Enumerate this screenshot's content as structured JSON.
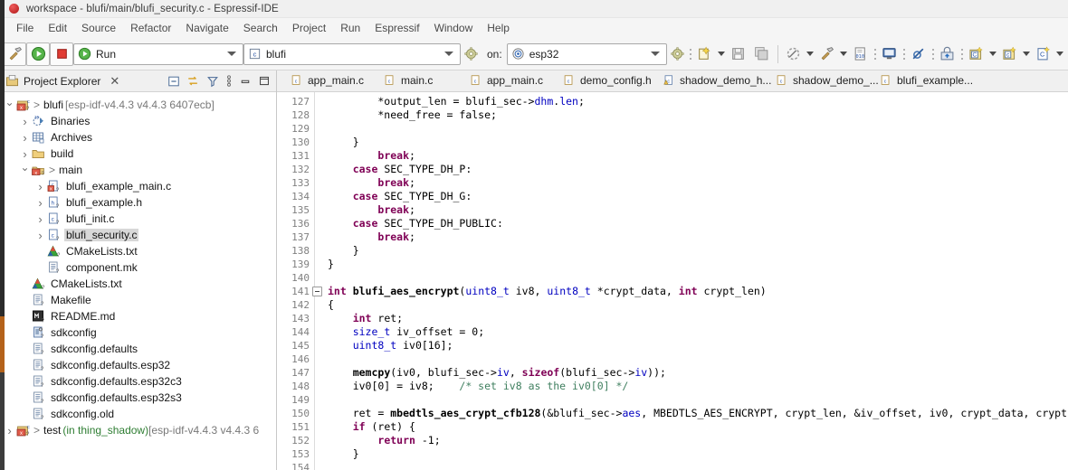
{
  "window": {
    "title": "workspace - blufi/main/blufi_security.c - Espressif-IDE",
    "app_icon": "espressif-logo-icon"
  },
  "menubar": {
    "items": [
      "File",
      "Edit",
      "Source",
      "Refactor",
      "Navigate",
      "Search",
      "Project",
      "Run",
      "Espressif",
      "Window",
      "Help"
    ]
  },
  "toolbar": {
    "build_button": "hammer-build-icon",
    "run_button": "run-green-play-icon",
    "stop_button": "stop-red-square-icon",
    "launch_mode": {
      "label": "Run",
      "icon": "run-green-play-icon",
      "caret": "chevron-down-icon"
    },
    "project_combo": {
      "label": "blufi",
      "icon": "c-project-icon",
      "caret": "chevron-down-icon",
      "gear": "gear-icon"
    },
    "on_label": "on:",
    "target_combo": {
      "label": "esp32",
      "icon": "target-chip-icon",
      "caret": "chevron-down-icon",
      "gear": "gear-icon"
    },
    "icons": [
      "new-file-icon",
      "save-icon",
      "save-all-icon",
      "build-all-icon",
      "hammer-build-icon",
      "binary-file-icon",
      "open-terminal-icon",
      "skip-breakpoints-icon",
      "open-perspective-icon",
      "new-c-class-icon",
      "new-c-file-icon",
      "new-c-source-icon",
      "git-icon"
    ]
  },
  "project_explorer": {
    "title": "Project Explorer",
    "close_icon": "close-icon",
    "tools": [
      "collapse-all-icon",
      "link-with-editor-icon",
      "view-filter-icon",
      "view-menu-icon",
      "minimize-icon",
      "maximize-icon"
    ],
    "tree": [
      {
        "indent": 0,
        "arrow": "open",
        "icon": "c-project-icon",
        "label": "blufi",
        "suffix": "[esp-idf-v4.4.3 v4.4.3 6407ecb]",
        "prefix_arrow": ">"
      },
      {
        "indent": 1,
        "arrow": "closed",
        "icon": "binaries-icon",
        "label": "Binaries"
      },
      {
        "indent": 1,
        "arrow": "closed",
        "icon": "archives-icon",
        "label": "Archives"
      },
      {
        "indent": 1,
        "arrow": "closed",
        "icon": "folder-icon",
        "label": "build"
      },
      {
        "indent": 1,
        "arrow": "open",
        "icon": "source-folder-icon",
        "label": "main",
        "prefix_arrow": ">"
      },
      {
        "indent": 2,
        "arrow": "closed",
        "icon": "c-file-error-icon",
        "label": "blufi_example_main.c"
      },
      {
        "indent": 2,
        "arrow": "closed",
        "icon": "h-file-icon",
        "label": "blufi_example.h"
      },
      {
        "indent": 2,
        "arrow": "closed",
        "icon": "c-file-icon",
        "label": "blufi_init.c"
      },
      {
        "indent": 2,
        "arrow": "closed",
        "icon": "c-file-icon",
        "label": "blufi_security.c",
        "selected": true
      },
      {
        "indent": 2,
        "arrow": "none",
        "icon": "cmake-icon",
        "label": "CMakeLists.txt"
      },
      {
        "indent": 2,
        "arrow": "none",
        "icon": "text-file-icon",
        "label": "component.mk"
      },
      {
        "indent": 1,
        "arrow": "none",
        "icon": "cmake-icon",
        "label": "CMakeLists.txt"
      },
      {
        "indent": 1,
        "arrow": "none",
        "icon": "text-file-icon",
        "label": "Makefile"
      },
      {
        "indent": 1,
        "arrow": "none",
        "icon": "markdown-icon",
        "label": "README.md"
      },
      {
        "indent": 1,
        "arrow": "none",
        "icon": "sdkconfig-icon",
        "label": "sdkconfig"
      },
      {
        "indent": 1,
        "arrow": "none",
        "icon": "text-file-icon",
        "label": "sdkconfig.defaults"
      },
      {
        "indent": 1,
        "arrow": "none",
        "icon": "text-file-icon",
        "label": "sdkconfig.defaults.esp32"
      },
      {
        "indent": 1,
        "arrow": "none",
        "icon": "text-file-icon",
        "label": "sdkconfig.defaults.esp32c3"
      },
      {
        "indent": 1,
        "arrow": "none",
        "icon": "text-file-icon",
        "label": "sdkconfig.defaults.esp32s3"
      },
      {
        "indent": 1,
        "arrow": "none",
        "icon": "text-file-icon",
        "label": "sdkconfig.old"
      },
      {
        "indent": 0,
        "arrow": "closed",
        "icon": "c-project-icon",
        "label": "test",
        "green": "(in thing_shadow)",
        "suffix": "[esp-idf-v4.4.3 v4.4.3 6",
        "prefix_arrow": ">"
      }
    ]
  },
  "editor_tabs": [
    {
      "label": "app_main.c",
      "icon": "c-file-icon"
    },
    {
      "label": "main.c",
      "icon": "c-file-icon"
    },
    {
      "label": "app_main.c",
      "icon": "c-file-icon"
    },
    {
      "label": "demo_config.h",
      "icon": "c-file-icon"
    },
    {
      "label": "shadow_demo_h...",
      "icon": "c-file-warning-icon"
    },
    {
      "label": "shadow_demo_...",
      "icon": "c-file-icon"
    },
    {
      "label": "blufi_example...",
      "icon": "c-file-icon"
    }
  ],
  "editor": {
    "first_line": 127,
    "lines": [
      {
        "n": 127,
        "tokens": [
          {
            "t": "        *output_len = blufi_sec->",
            "c": ""
          },
          {
            "t": "dhm",
            "c": "fld"
          },
          {
            "t": ".",
            "c": ""
          },
          {
            "t": "len",
            "c": "fld"
          },
          {
            "t": ";",
            "c": ""
          }
        ]
      },
      {
        "n": 128,
        "tokens": [
          {
            "t": "        *need_free = ",
            "c": ""
          },
          {
            "t": "false",
            "c": ""
          },
          {
            "t": ";",
            "c": ""
          }
        ]
      },
      {
        "n": 129,
        "tokens": []
      },
      {
        "n": 130,
        "tokens": [
          {
            "t": "    }",
            "c": ""
          }
        ]
      },
      {
        "n": 131,
        "tokens": [
          {
            "t": "        ",
            "c": ""
          },
          {
            "t": "break",
            "c": "kw"
          },
          {
            "t": ";",
            "c": ""
          }
        ]
      },
      {
        "n": 132,
        "tokens": [
          {
            "t": "    ",
            "c": ""
          },
          {
            "t": "case",
            "c": "kw"
          },
          {
            "t": " SEC_TYPE_DH_P:",
            "c": ""
          }
        ]
      },
      {
        "n": 133,
        "tokens": [
          {
            "t": "        ",
            "c": ""
          },
          {
            "t": "break",
            "c": "kw"
          },
          {
            "t": ";",
            "c": ""
          }
        ]
      },
      {
        "n": 134,
        "tokens": [
          {
            "t": "    ",
            "c": ""
          },
          {
            "t": "case",
            "c": "kw"
          },
          {
            "t": " SEC_TYPE_DH_G:",
            "c": ""
          }
        ]
      },
      {
        "n": 135,
        "tokens": [
          {
            "t": "        ",
            "c": ""
          },
          {
            "t": "break",
            "c": "kw"
          },
          {
            "t": ";",
            "c": ""
          }
        ]
      },
      {
        "n": 136,
        "tokens": [
          {
            "t": "    ",
            "c": ""
          },
          {
            "t": "case",
            "c": "kw"
          },
          {
            "t": " SEC_TYPE_DH_PUBLIC:",
            "c": ""
          }
        ]
      },
      {
        "n": 137,
        "tokens": [
          {
            "t": "        ",
            "c": ""
          },
          {
            "t": "break",
            "c": "kw"
          },
          {
            "t": ";",
            "c": ""
          }
        ]
      },
      {
        "n": 138,
        "tokens": [
          {
            "t": "    }",
            "c": ""
          }
        ]
      },
      {
        "n": 139,
        "tokens": [
          {
            "t": "}",
            "c": ""
          }
        ]
      },
      {
        "n": 140,
        "tokens": []
      },
      {
        "n": 141,
        "fold": true,
        "tokens": [
          {
            "t": "int",
            "c": "kw"
          },
          {
            "t": " ",
            "c": ""
          },
          {
            "t": "blufi_aes_encrypt",
            "c": "fn"
          },
          {
            "t": "(",
            "c": ""
          },
          {
            "t": "uint8_t",
            "c": "fld"
          },
          {
            "t": " iv8, ",
            "c": ""
          },
          {
            "t": "uint8_t",
            "c": "fld"
          },
          {
            "t": " *crypt_data, ",
            "c": ""
          },
          {
            "t": "int",
            "c": "kw"
          },
          {
            "t": " crypt_len)",
            "c": ""
          }
        ]
      },
      {
        "n": 142,
        "tokens": [
          {
            "t": "{",
            "c": ""
          }
        ]
      },
      {
        "n": 143,
        "tokens": [
          {
            "t": "    ",
            "c": ""
          },
          {
            "t": "int",
            "c": "kw"
          },
          {
            "t": " ret;",
            "c": ""
          }
        ]
      },
      {
        "n": 144,
        "tokens": [
          {
            "t": "    ",
            "c": ""
          },
          {
            "t": "size_t",
            "c": "fld"
          },
          {
            "t": " iv_offset = ",
            "c": ""
          },
          {
            "t": "0",
            "c": ""
          },
          {
            "t": ";",
            "c": ""
          }
        ]
      },
      {
        "n": 145,
        "tokens": [
          {
            "t": "    ",
            "c": ""
          },
          {
            "t": "uint8_t",
            "c": "fld"
          },
          {
            "t": " iv0[16];",
            "c": ""
          }
        ]
      },
      {
        "n": 146,
        "tokens": []
      },
      {
        "n": 147,
        "tokens": [
          {
            "t": "    ",
            "c": ""
          },
          {
            "t": "memcpy",
            "c": "fn"
          },
          {
            "t": "(iv0, blufi_sec->",
            "c": ""
          },
          {
            "t": "iv",
            "c": "fld"
          },
          {
            "t": ", ",
            "c": ""
          },
          {
            "t": "sizeof",
            "c": "kw"
          },
          {
            "t": "(blufi_sec->",
            "c": ""
          },
          {
            "t": "iv",
            "c": "fld"
          },
          {
            "t": "));",
            "c": ""
          }
        ]
      },
      {
        "n": 148,
        "tokens": [
          {
            "t": "    iv0[0] = iv8;    ",
            "c": ""
          },
          {
            "t": "/* set iv8 as the iv0[0] */",
            "c": "cm"
          }
        ]
      },
      {
        "n": 149,
        "tokens": []
      },
      {
        "n": 150,
        "tokens": [
          {
            "t": "    ret = ",
            "c": ""
          },
          {
            "t": "mbedtls_aes_crypt_cfb128",
            "c": "fn"
          },
          {
            "t": "(&blufi_sec->",
            "c": ""
          },
          {
            "t": "aes",
            "c": "fld"
          },
          {
            "t": ", MBEDTLS_AES_ENCRYPT, crypt_len, &iv_offset, iv0, crypt_data, crypt",
            "c": ""
          }
        ]
      },
      {
        "n": 151,
        "tokens": [
          {
            "t": "    ",
            "c": ""
          },
          {
            "t": "if",
            "c": "kw"
          },
          {
            "t": " (ret) {",
            "c": ""
          }
        ]
      },
      {
        "n": 152,
        "tokens": [
          {
            "t": "        ",
            "c": ""
          },
          {
            "t": "return",
            "c": "kw"
          },
          {
            "t": " -",
            "c": ""
          },
          {
            "t": "1",
            "c": ""
          },
          {
            "t": ";",
            "c": ""
          }
        ]
      },
      {
        "n": 153,
        "tokens": [
          {
            "t": "    }",
            "c": ""
          }
        ]
      },
      {
        "n": 154,
        "tokens": []
      }
    ]
  },
  "colors": {
    "keyword": "#7f0055",
    "comment": "#3f7f5f",
    "field": "#0000c0",
    "accent_orange": "#b4621a",
    "toolbar_bg": "#f5f5f5"
  }
}
